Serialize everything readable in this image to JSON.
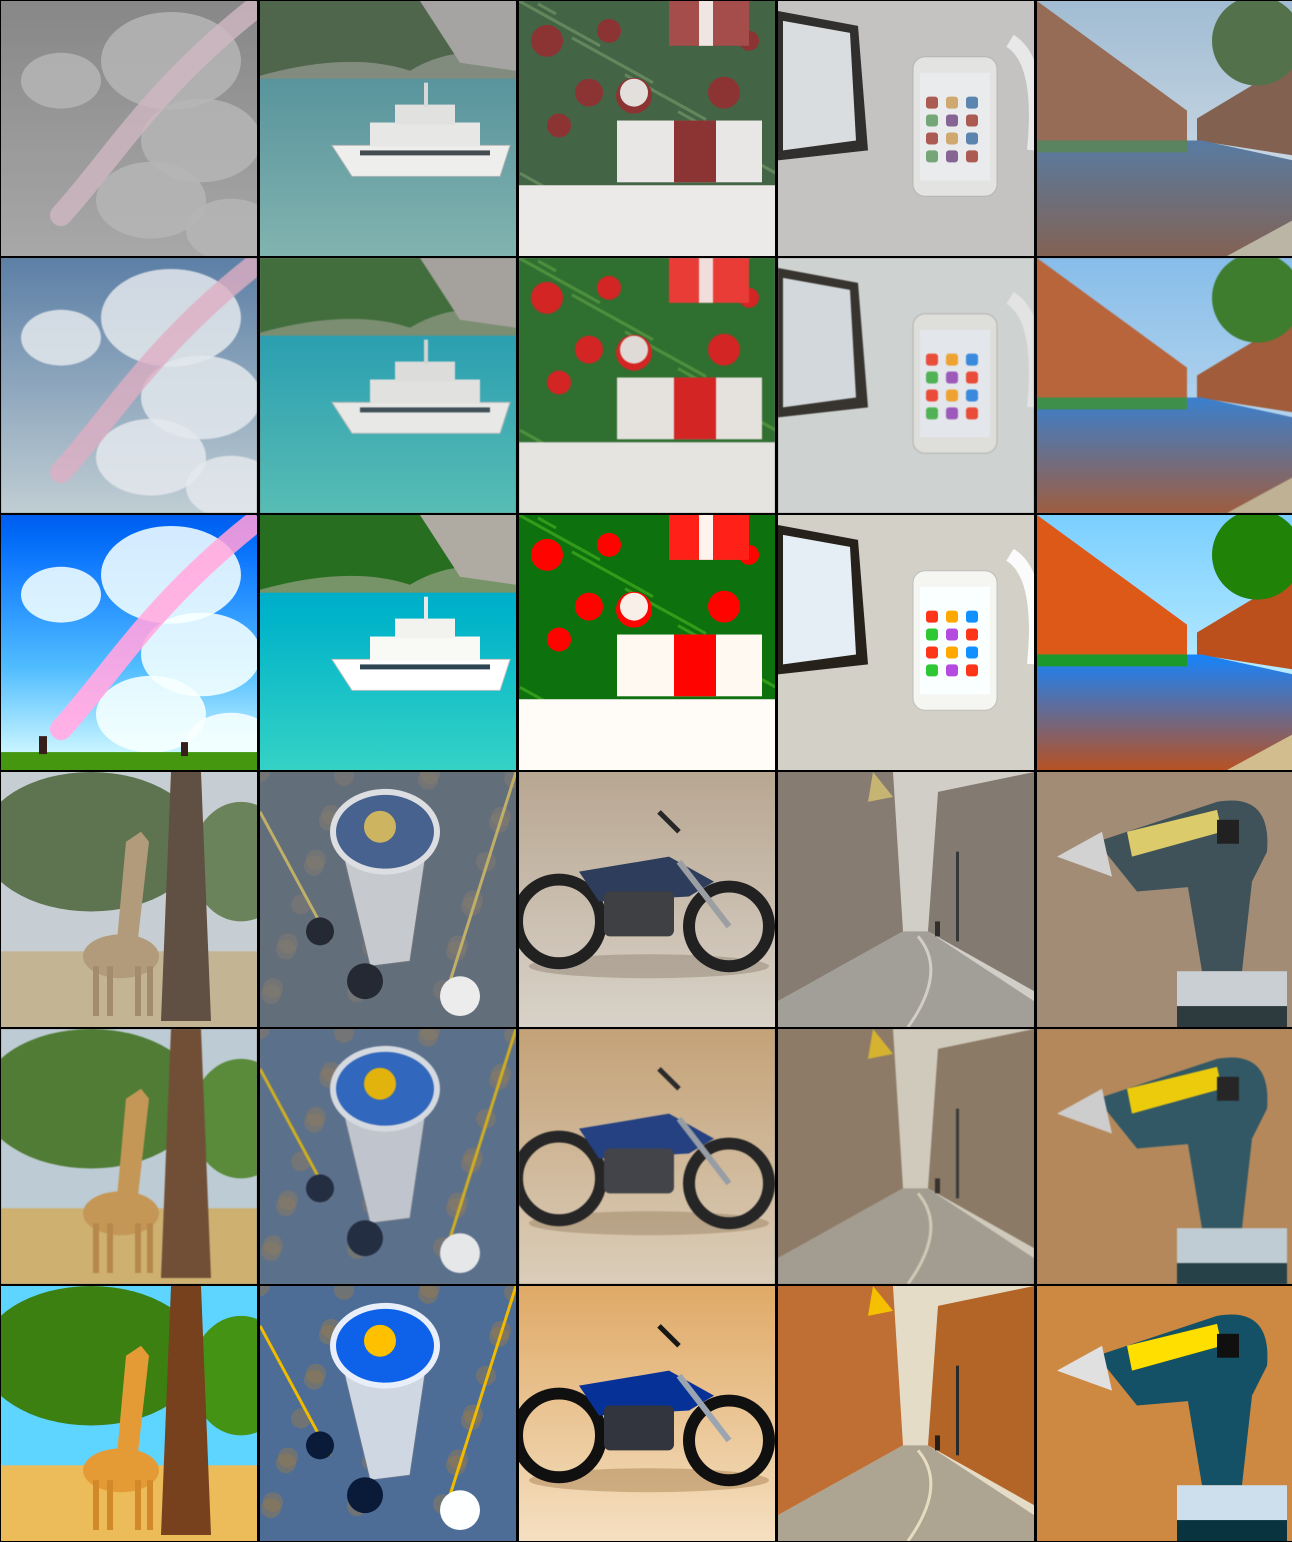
{
  "grid": {
    "columns": 5,
    "rows": 6,
    "subjects_top": [
      "cloud-sky",
      "yacht",
      "christmas-gift",
      "smartphone",
      "canal-street"
    ],
    "subjects_bottom": [
      "giraffe",
      "space-station",
      "motorcycle",
      "old-town-street",
      "power-drill"
    ],
    "variants": [
      "original",
      "painterly-reconstruction",
      "anime-stylized"
    ]
  },
  "colors": {
    "background": "#000000",
    "sky_blue": "#3e7fd0",
    "sea_teal": "#5fc0b8",
    "christmas_red": "#c8201e",
    "christmas_green": "#2d6b2e",
    "canal_brick": "#b5643c",
    "drill_yellow": "#f2d21a",
    "drill_teal": "#2e5360",
    "motorcycle_blue": "#1f3a78",
    "backdrop_tan": "#b48a5e"
  }
}
